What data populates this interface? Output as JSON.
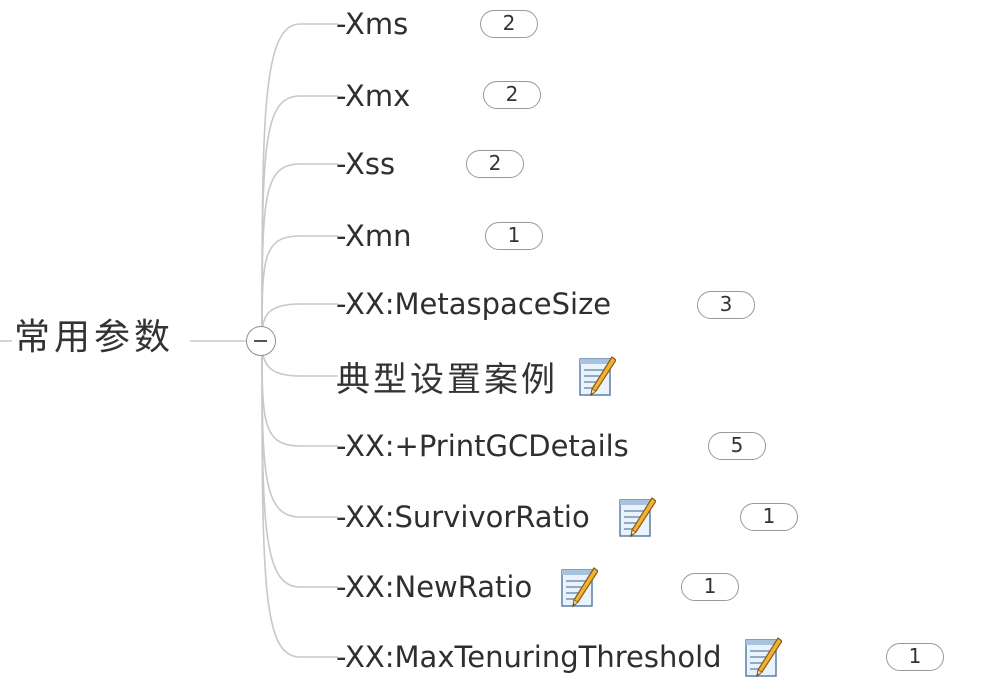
{
  "root": {
    "label": "常用参数",
    "collapse_symbol": "−"
  },
  "topics": [
    {
      "label": "-Xms",
      "badge": "2"
    },
    {
      "label": "-Xmx",
      "badge": "2"
    },
    {
      "label": "-Xss",
      "badge": "2"
    },
    {
      "label": "-Xmn",
      "badge": "1"
    },
    {
      "label": "-XX:MetaspaceSize",
      "badge": "3"
    },
    {
      "label": "典型设置案例",
      "icon": "note-pencil-icon"
    },
    {
      "label": "-XX:+PrintGCDetails",
      "badge": "5"
    },
    {
      "label": "-XX:SurvivorRatio",
      "icon": "note-pencil-icon",
      "badge": "1"
    },
    {
      "label": "-XX:NewRatio",
      "icon": "note-pencil-icon",
      "badge": "1"
    },
    {
      "label": "-XX:MaxTenuringThreshold",
      "icon": "note-pencil-icon",
      "badge": "1"
    }
  ],
  "colors": {
    "connector": "#c8c8c8",
    "badge_border": "#9a9a9a",
    "text": "#2f2f2f"
  }
}
